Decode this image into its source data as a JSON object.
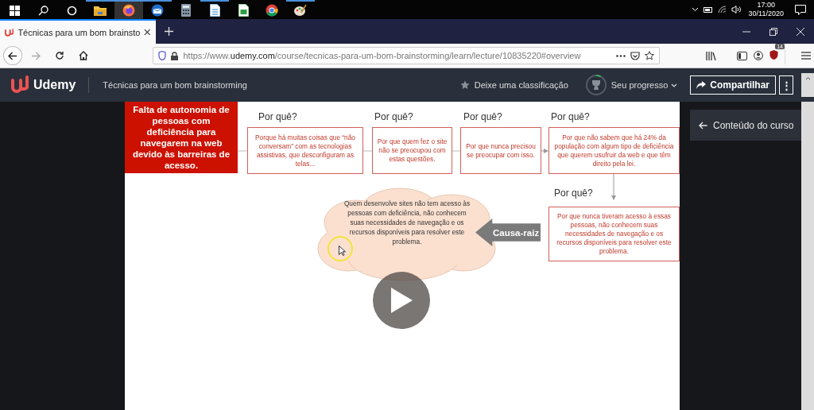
{
  "taskbar": {
    "clock_time": "17:00",
    "clock_date": "30/11/2020"
  },
  "browser": {
    "tab": {
      "title": "Técnicas para um bom brainsto",
      "selected": true
    },
    "address": {
      "scheme": "https://www.",
      "domain": "udemy.com",
      "path": "/course/tecnicas-para-um-bom-brainstorming/learn/lecture/10835220#overview"
    },
    "extension_badge": "14"
  },
  "header": {
    "logo": "Udemy",
    "course_title": "Técnicas para um bom brainstorming",
    "rate_link": "Deixe uma classificação",
    "progress": {
      "label": "Seu progresso",
      "level": 0.08
    },
    "share_button": "Compartilhar",
    "more_button": "⋮"
  },
  "slide": {
    "problem": "Falta de autonomia de pessoas com deficiência para navegarem na web devido às barreiras de acesso.",
    "whys": [
      {
        "label": "Por quê?",
        "text": "Porque há muitas coisas que “não conversam” com as tecnologias assistivas, que desconfiguram as telas..."
      },
      {
        "label": "Por quê?",
        "text": "Por que quem fez o site não se preocupou com estas questões."
      },
      {
        "label": "Por quê?",
        "text": "Por que nunca precisou se preocupar com isso."
      },
      {
        "label": "Por quê?",
        "text": "Por que não sabem que há 24% da população com algum tipo de deficiência que querem usufruir da web e que têm direito pela lei."
      },
      {
        "label": "Por quê?",
        "text": "Por que nunca tiveram acesso à essas pessoas, não conhecem suas necessidades de navegação e os recursos disponíveis para resolver este problema."
      }
    ],
    "root_cause": "Quem desenvolve sites não tem acesso às pessoas com deficiência, não conhecem suas necessidades de navegação e os recursos disponíveis para resolver este problema.",
    "root_cause_label": "Causa-raiz"
  },
  "course_content_button": "Conteúdo do curso"
}
